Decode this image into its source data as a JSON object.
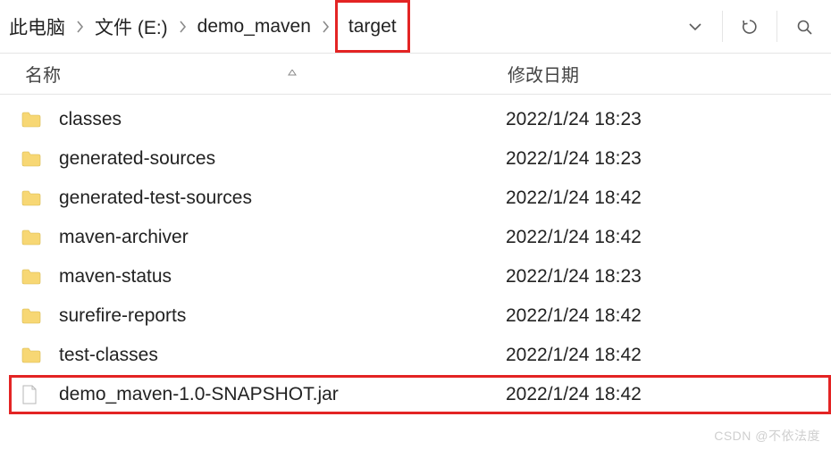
{
  "breadcrumb": {
    "segments": [
      "此电脑",
      "文件 (E:)",
      "demo_maven",
      "target"
    ],
    "highlightIndex": 3
  },
  "columns": {
    "name": "名称",
    "date": "修改日期"
  },
  "items": [
    {
      "type": "folder",
      "name": "classes",
      "date": "2022/1/24 18:23",
      "hl": false
    },
    {
      "type": "folder",
      "name": "generated-sources",
      "date": "2022/1/24 18:23",
      "hl": false
    },
    {
      "type": "folder",
      "name": "generated-test-sources",
      "date": "2022/1/24 18:42",
      "hl": false
    },
    {
      "type": "folder",
      "name": "maven-archiver",
      "date": "2022/1/24 18:42",
      "hl": false
    },
    {
      "type": "folder",
      "name": "maven-status",
      "date": "2022/1/24 18:23",
      "hl": false
    },
    {
      "type": "folder",
      "name": "surefire-reports",
      "date": "2022/1/24 18:42",
      "hl": false
    },
    {
      "type": "folder",
      "name": "test-classes",
      "date": "2022/1/24 18:42",
      "hl": false
    },
    {
      "type": "file",
      "name": "demo_maven-1.0-SNAPSHOT.jar",
      "date": "2022/1/24 18:42",
      "hl": true
    }
  ],
  "watermark": "CSDN @不依法度"
}
